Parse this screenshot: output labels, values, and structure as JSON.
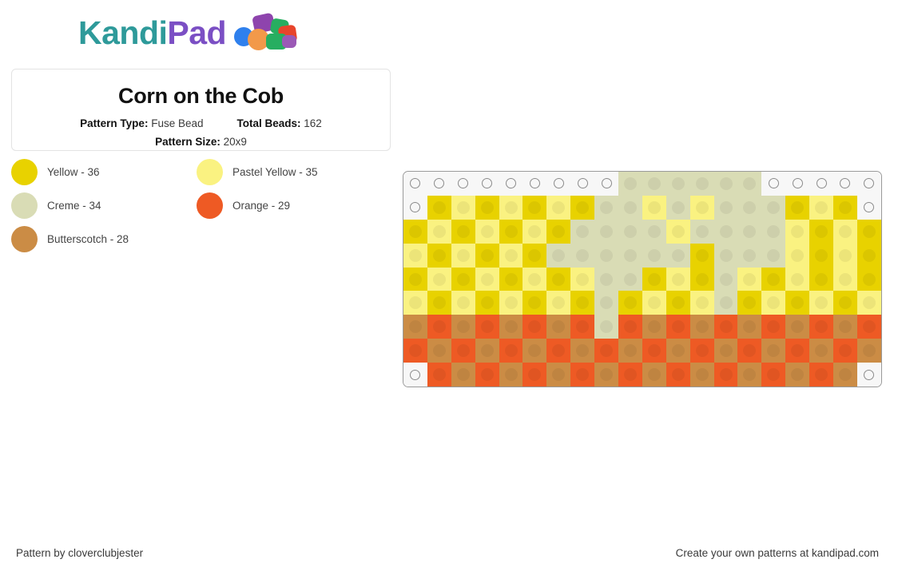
{
  "brand": {
    "name_part1": "Kandi",
    "name_part2": "Pad",
    "color1": "#2e9a9a",
    "color2": "#7b4fc4"
  },
  "card": {
    "title": "Corn on the Cob",
    "pattern_type_label": "Pattern Type:",
    "pattern_type_value": "Fuse Bead",
    "total_beads_label": "Total Beads:",
    "total_beads_value": "162",
    "pattern_size_label": "Pattern Size:",
    "pattern_size_value": "20x9"
  },
  "legend": [
    {
      "name": "Yellow - 36",
      "color": "#e8d200"
    },
    {
      "name": "Pastel Yellow - 35",
      "color": "#faf281"
    },
    {
      "name": "Creme - 34",
      "color": "#d9dcb5"
    },
    {
      "name": "Orange - 29",
      "color": "#ee5a24"
    },
    {
      "name": "Butterscotch - 28",
      "color": "#cb8c45"
    }
  ],
  "palette": {
    "Y": "#e8d200",
    "P": "#faf281",
    "C": "#d9dcb5",
    "O": "#ee5a24",
    "B": "#cb8c45",
    "_": null
  },
  "grid": {
    "cols": 20,
    "rows": 9,
    "cells": [
      [
        "_",
        "_",
        "_",
        "_",
        "_",
        "_",
        "_",
        "_",
        "_",
        "C",
        "C",
        "C",
        "C",
        "C",
        "C",
        "_",
        "_",
        "_",
        "_",
        "_"
      ],
      [
        "_",
        "Y",
        "P",
        "Y",
        "P",
        "Y",
        "P",
        "Y",
        "C",
        "C",
        "P",
        "C",
        "P",
        "C",
        "C",
        "C",
        "Y",
        "P",
        "Y",
        "_"
      ],
      [
        "Y",
        "P",
        "Y",
        "P",
        "Y",
        "P",
        "Y",
        "C",
        "C",
        "C",
        "C",
        "P",
        "C",
        "C",
        "C",
        "C",
        "P",
        "Y",
        "P",
        "Y"
      ],
      [
        "P",
        "Y",
        "P",
        "Y",
        "P",
        "Y",
        "C",
        "C",
        "C",
        "C",
        "C",
        "C",
        "Y",
        "C",
        "C",
        "C",
        "P",
        "Y",
        "P",
        "Y"
      ],
      [
        "Y",
        "P",
        "Y",
        "P",
        "Y",
        "P",
        "Y",
        "P",
        "C",
        "C",
        "Y",
        "P",
        "Y",
        "C",
        "P",
        "Y",
        "P",
        "Y",
        "P",
        "Y"
      ],
      [
        "P",
        "Y",
        "P",
        "Y",
        "P",
        "Y",
        "P",
        "Y",
        "C",
        "Y",
        "P",
        "Y",
        "P",
        "C",
        "Y",
        "P",
        "Y",
        "P",
        "Y",
        "P"
      ],
      [
        "B",
        "O",
        "B",
        "O",
        "B",
        "O",
        "B",
        "O",
        "C",
        "O",
        "B",
        "O",
        "B",
        "O",
        "B",
        "O",
        "B",
        "O",
        "B",
        "O"
      ],
      [
        "O",
        "B",
        "O",
        "B",
        "O",
        "B",
        "O",
        "B",
        "O",
        "B",
        "O",
        "B",
        "O",
        "B",
        "O",
        "B",
        "O",
        "B",
        "O",
        "B"
      ],
      [
        "_",
        "O",
        "B",
        "O",
        "B",
        "O",
        "B",
        "O",
        "B",
        "O",
        "B",
        "O",
        "B",
        "O",
        "B",
        "O",
        "B",
        "O",
        "B",
        "_"
      ]
    ]
  },
  "footer": {
    "left": "Pattern by cloverclubjester",
    "right": "Create your own patterns at kandipad.com"
  }
}
